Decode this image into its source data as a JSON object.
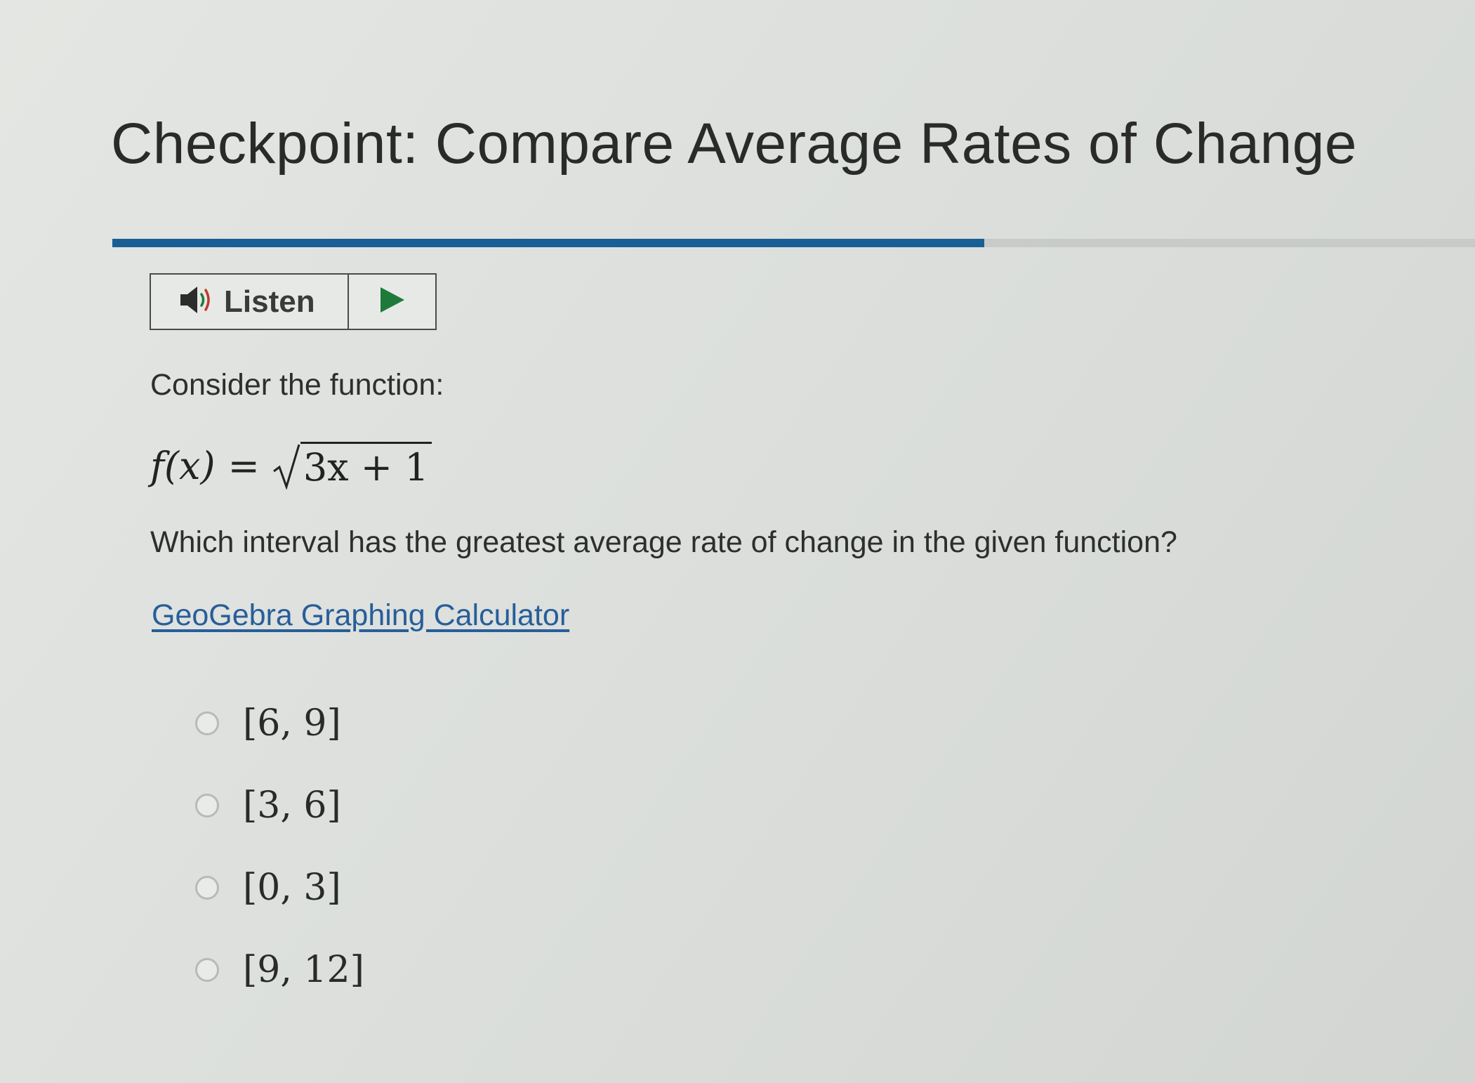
{
  "page": {
    "title": "Checkpoint: Compare Average Rates of Change",
    "progress_percent": 64
  },
  "listen": {
    "label": "Listen",
    "speaker_icon": "speaker-icon",
    "play_icon": "play-icon",
    "accent_color": "#1d7a3a"
  },
  "question": {
    "prompt": "Consider the function:",
    "formula": {
      "lhs": "f(x)",
      "equals": "=",
      "radicand": "3x + 1"
    },
    "text": "Which interval has the greatest average rate of change in the given function?",
    "link_text": "GeoGebra Graphing Calculator"
  },
  "options": [
    {
      "label": "[6, 9]"
    },
    {
      "label": "[3, 6]"
    },
    {
      "label": "[0, 3]"
    },
    {
      "label": "[9, 12]"
    }
  ],
  "colors": {
    "progress": "#1a5e96",
    "link": "#275e9a"
  }
}
